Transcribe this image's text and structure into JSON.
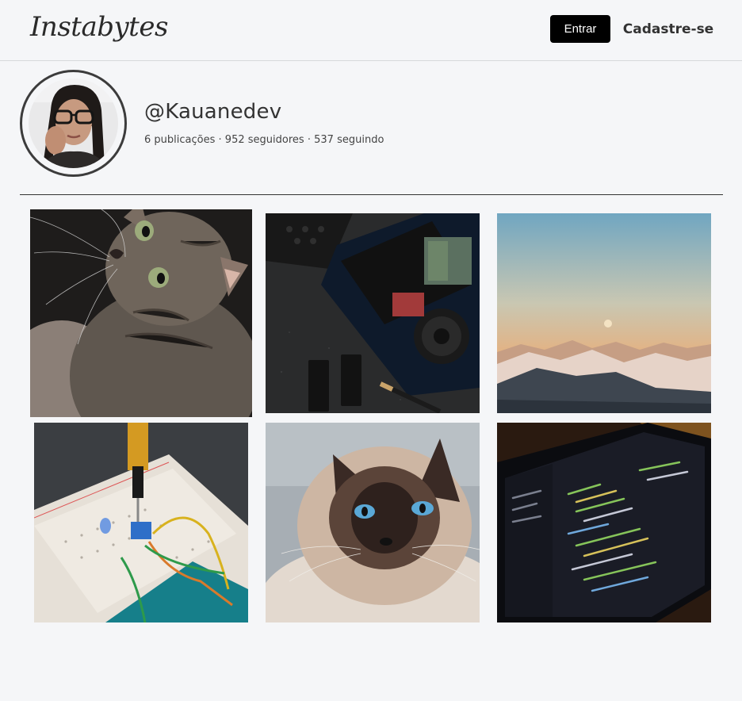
{
  "header": {
    "logo": "Instabytes",
    "login_label": "Entrar",
    "signup_label": "Cadastre-se"
  },
  "profile": {
    "username": "@Kauanedev",
    "posts_count": "6",
    "posts_label": "publicações",
    "followers_count": "952",
    "followers_label": "seguidores",
    "following_count": "537",
    "following_label": "seguindo"
  },
  "posts": [
    {
      "subject": "tabby-cat"
    },
    {
      "subject": "laptop-internals"
    },
    {
      "subject": "mountain-sunset"
    },
    {
      "subject": "breadboard-arduino"
    },
    {
      "subject": "siamese-cat"
    },
    {
      "subject": "code-screen"
    }
  ]
}
